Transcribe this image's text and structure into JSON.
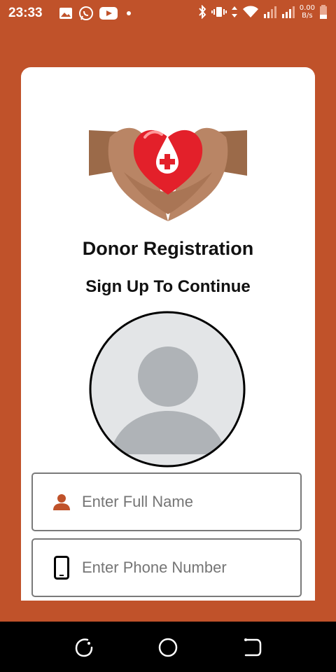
{
  "status_bar": {
    "time": "23:33",
    "speed_value": "0.00",
    "speed_unit": "B/s",
    "icons": [
      "image-icon",
      "whatsapp-icon",
      "youtube-icon",
      "dot-icon",
      "bluetooth-icon",
      "vibrate-icon",
      "data-arrows-icon",
      "wifi-icon",
      "signal-icon",
      "signal-icon",
      "battery-icon"
    ]
  },
  "registration": {
    "title": "Donor Registration",
    "subtitle": "Sign Up To Continue"
  },
  "form": {
    "name_placeholder": "Enter Full Name",
    "phone_placeholder": "Enter Phone Number"
  },
  "colors": {
    "accent": "#c0522a",
    "card": "#ffffff",
    "heart": "#e3202a"
  },
  "nav": {
    "icons": [
      "recent-apps-icon",
      "home-icon",
      "back-icon"
    ]
  }
}
